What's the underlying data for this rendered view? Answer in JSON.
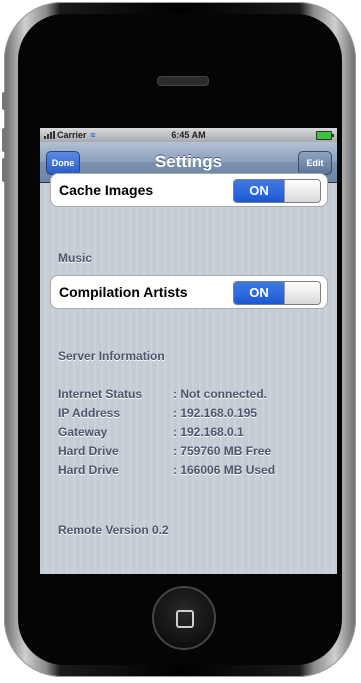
{
  "status_bar": {
    "carrier": "Carrier",
    "time": "6:45 AM",
    "wifi_icon": "wifi-icon",
    "battery_icon": "battery-icon"
  },
  "nav": {
    "title": "Settings",
    "left_button": "Done",
    "right_button": "Edit"
  },
  "settings": {
    "cache_images": {
      "label": "Cache Images",
      "value": "ON"
    },
    "music_header": "Music",
    "compilation_artists": {
      "label": "Compilation Artists",
      "value": "ON"
    }
  },
  "server_info": {
    "header": "Server Information",
    "rows": [
      {
        "label": "Internet Status",
        "value": ": Not connected."
      },
      {
        "label": "IP Address",
        "value": ": 192.168.0.195"
      },
      {
        "label": "Gateway",
        "value": ": 192.168.0.1"
      },
      {
        "label": "Hard Drive",
        "value": ": 759760 MB Free"
      },
      {
        "label": "Hard Drive",
        "value": ": 166006 MB Used"
      }
    ]
  },
  "footer": {
    "version": "Remote Version 0.2"
  },
  "colors": {
    "accent": "#2f6be0",
    "nav": "#8aa0bb",
    "section_text": "#4c566c"
  }
}
